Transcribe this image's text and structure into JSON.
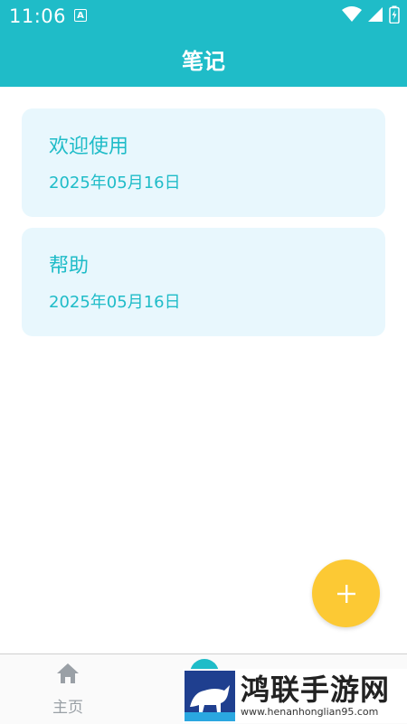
{
  "status": {
    "time": "11:06",
    "notif_icon": "A"
  },
  "header": {
    "title": "笔记"
  },
  "notes": [
    {
      "title": "欢迎使用",
      "date": "2025年05月16日"
    },
    {
      "title": "帮助",
      "date": "2025年05月16日"
    }
  ],
  "fab": {
    "icon": "plus-icon"
  },
  "bottom_nav": {
    "home_label": "主页"
  },
  "watermark": {
    "brand": "鸿联手游网",
    "url": "www.henanhonglian95.com"
  },
  "colors": {
    "primary": "#1fbcc8",
    "card_bg": "#e8f7fd",
    "fab": "#fcc934"
  }
}
